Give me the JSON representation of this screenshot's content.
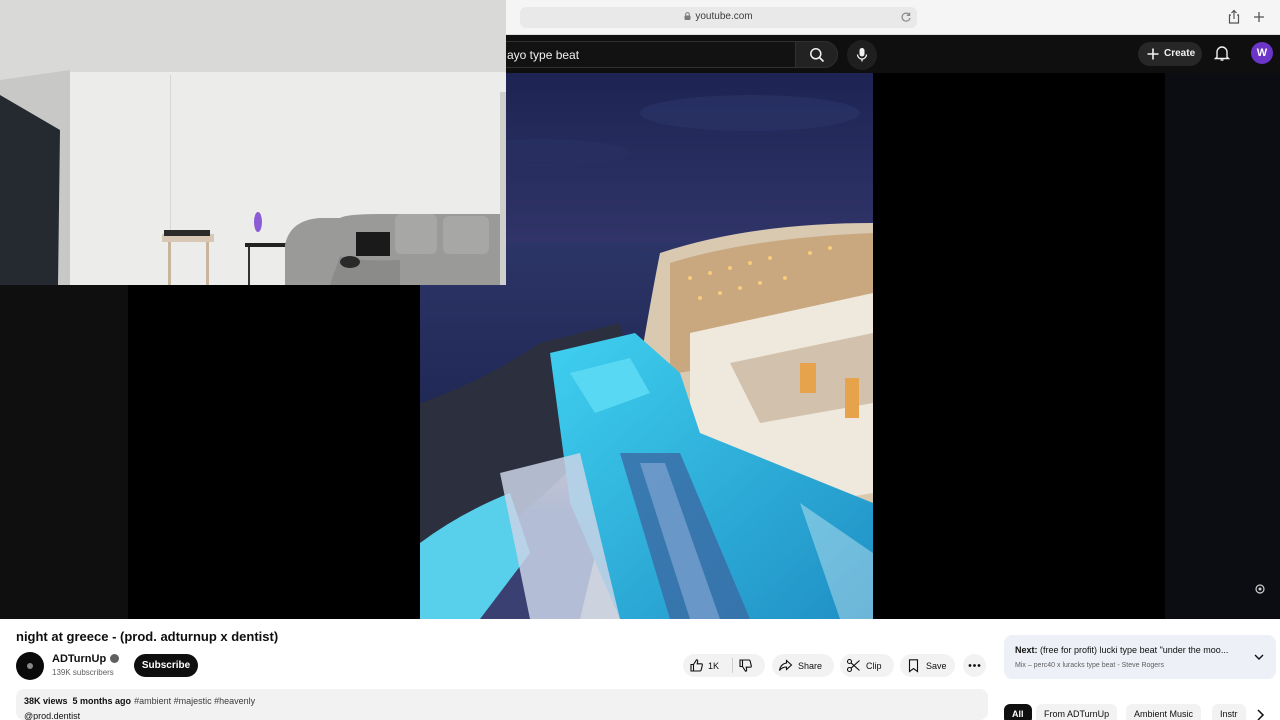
{
  "browser": {
    "url": "youtube.com"
  },
  "header": {
    "search_value": "ayo type beat",
    "create_label": "Create",
    "avatar_letter": "W"
  },
  "video": {
    "title": "night at greece - (prod. adturnup x dentist)",
    "channel": {
      "name": "ADTurnUp",
      "subscribers": "139K subscribers",
      "subscribe_label": "Subscribe"
    },
    "actions": {
      "likes": "1K",
      "share_label": "Share",
      "clip_label": "Clip",
      "save_label": "Save"
    },
    "description": {
      "views": "38K views",
      "age": "5 months ago",
      "tags": "#ambient #majestic #heavenly",
      "handle": "@prod.dentist"
    }
  },
  "up_next": {
    "prefix": "Next:",
    "title": "(free for profit) lucki type beat \"under the moo...",
    "subtitle": "Mix – perc40 x luracks type beat - Steve Rogers"
  },
  "chips": [
    "All",
    "From ADTurnUp",
    "Ambient Music",
    "Instr"
  ],
  "colors": {
    "youtube_dark": "#0f0f0f",
    "avatar_purple": "#6b35c9",
    "chip_active": "#0f0f0f",
    "next_card": "#eef0f7"
  },
  "icons": [
    "lock-icon",
    "reload-icon",
    "share-icon",
    "new-tab-icon",
    "search-icon",
    "mic-icon",
    "plus-icon",
    "bell-icon",
    "like-icon",
    "dislike-icon",
    "share-arrow-icon",
    "scissors-icon",
    "bookmark-icon",
    "more-icon",
    "chevron-down-icon",
    "chevron-right-icon",
    "verified-icon"
  ]
}
